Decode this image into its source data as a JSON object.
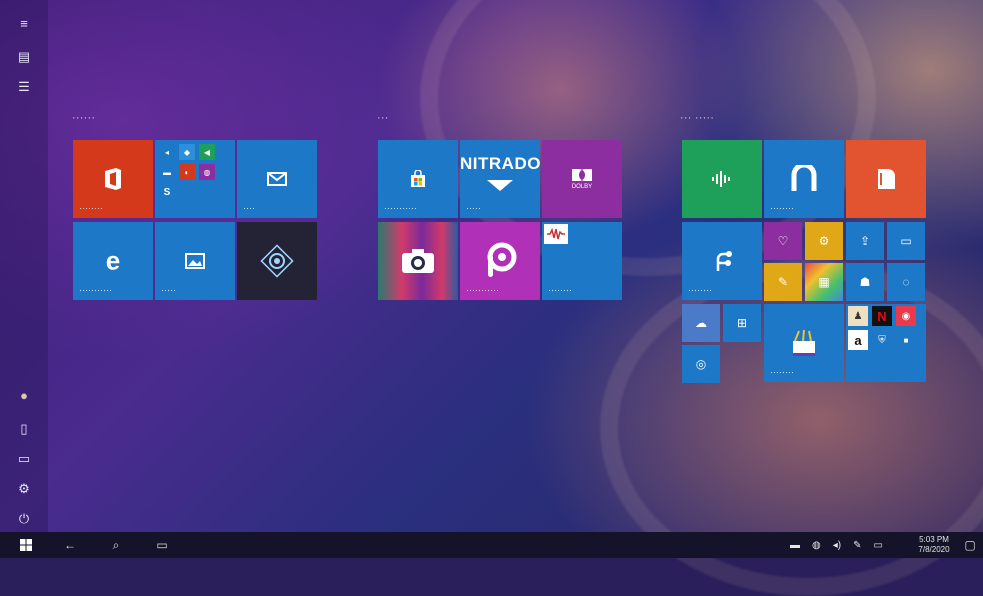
{
  "rail": {
    "items": [
      {
        "name": "hamburger-menu-icon",
        "glyph": "≡"
      },
      {
        "name": "all-apps-icon",
        "glyph": "▤"
      },
      {
        "name": "list-view-icon",
        "glyph": "☰"
      }
    ],
    "bottom": [
      {
        "name": "user-avatar-icon",
        "glyph": "●"
      },
      {
        "name": "documents-icon",
        "glyph": "▯"
      },
      {
        "name": "pictures-icon",
        "glyph": "▭"
      },
      {
        "name": "settings-icon",
        "glyph": "⚙"
      },
      {
        "name": "power-icon",
        "glyph": "⏻"
      }
    ]
  },
  "groups": {
    "group1": "······",
    "group2": "···",
    "group3": "··· ·····"
  },
  "tiles": {
    "office_label": "········",
    "mail_label": "····",
    "edge_label": "···········",
    "photos_label": "·····",
    "store_label": "···········",
    "nitrado_text": "NITRADO",
    "nitrado_label": "·····",
    "dolby_text": "DOLBY",
    "picsart_label": "···········",
    "app_label": "········"
  },
  "taskbar": {
    "time": "5:03 PM",
    "date": "7/8/2020"
  },
  "colors": {
    "tile_blue": "#1e78c8",
    "office_orange": "#d4391b",
    "dark_tile": "#242235",
    "green_tile": "#1ea05a",
    "purple_tile": "#8c2da0",
    "yellow_tile": "#e0a817"
  }
}
